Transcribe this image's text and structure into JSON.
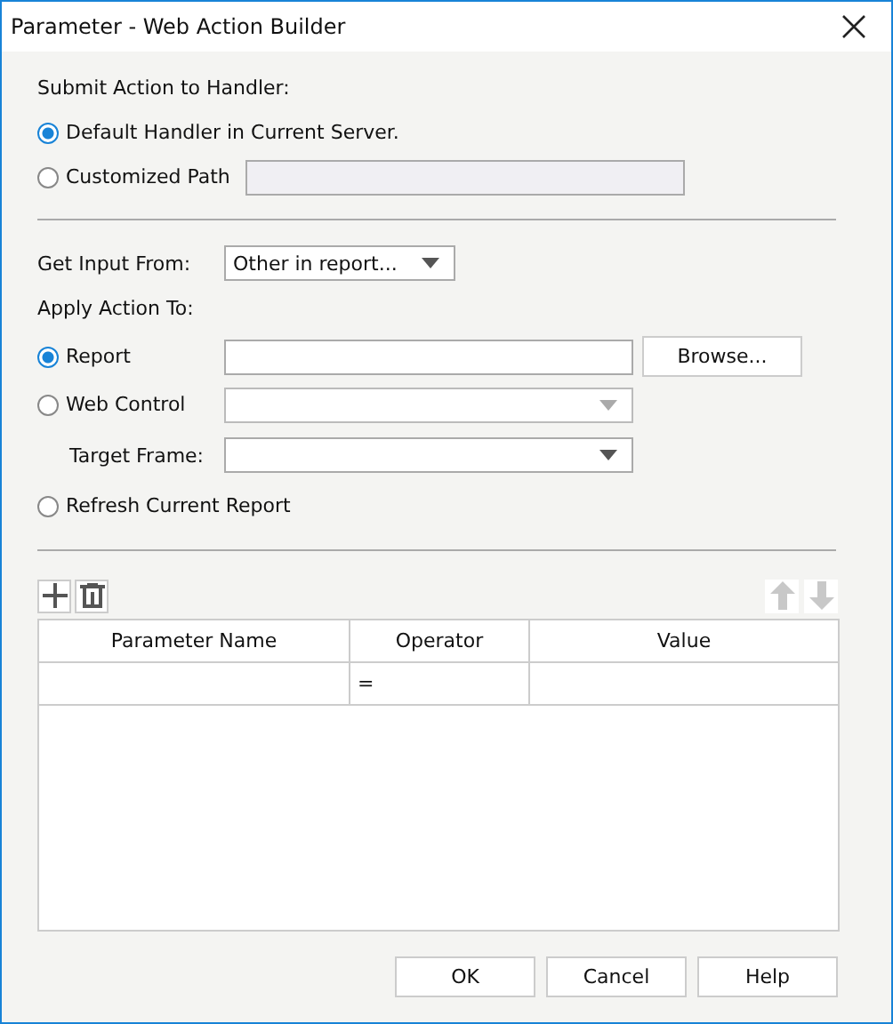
{
  "window": {
    "title": "Parameter - Web Action Builder"
  },
  "submit": {
    "heading": "Submit Action to Handler:",
    "options": [
      {
        "label": "Default Handler in Current Server.",
        "selected": true,
        "kind": "plain"
      },
      {
        "label": "Customized Path",
        "selected": false,
        "kind": "text",
        "disabled": true
      }
    ]
  },
  "input_from": {
    "label": "Get Input From:",
    "value": "Other in report..."
  },
  "apply": {
    "heading": "Apply Action To:",
    "options": [
      {
        "label": "Report",
        "selected": true,
        "kind": "browse",
        "button": "Browse..."
      },
      {
        "label": "Web Control",
        "selected": false,
        "kind": "dropdown",
        "disabled": true,
        "sub": {
          "label": "Target Frame:",
          "disabled": false
        }
      },
      {
        "label": "Refresh Current Report",
        "selected": false,
        "kind": "plain"
      }
    ]
  },
  "toolbar": {
    "add": {
      "disabled": false
    },
    "delete": {
      "disabled": false
    },
    "up": {
      "disabled": true
    },
    "down": {
      "disabled": true
    }
  },
  "table": {
    "columns": [
      "Parameter Name",
      "Operator",
      "Value"
    ],
    "rows": [
      [
        "",
        "=",
        ""
      ]
    ]
  },
  "buttons": [
    "OK",
    "Cancel",
    "Help"
  ]
}
